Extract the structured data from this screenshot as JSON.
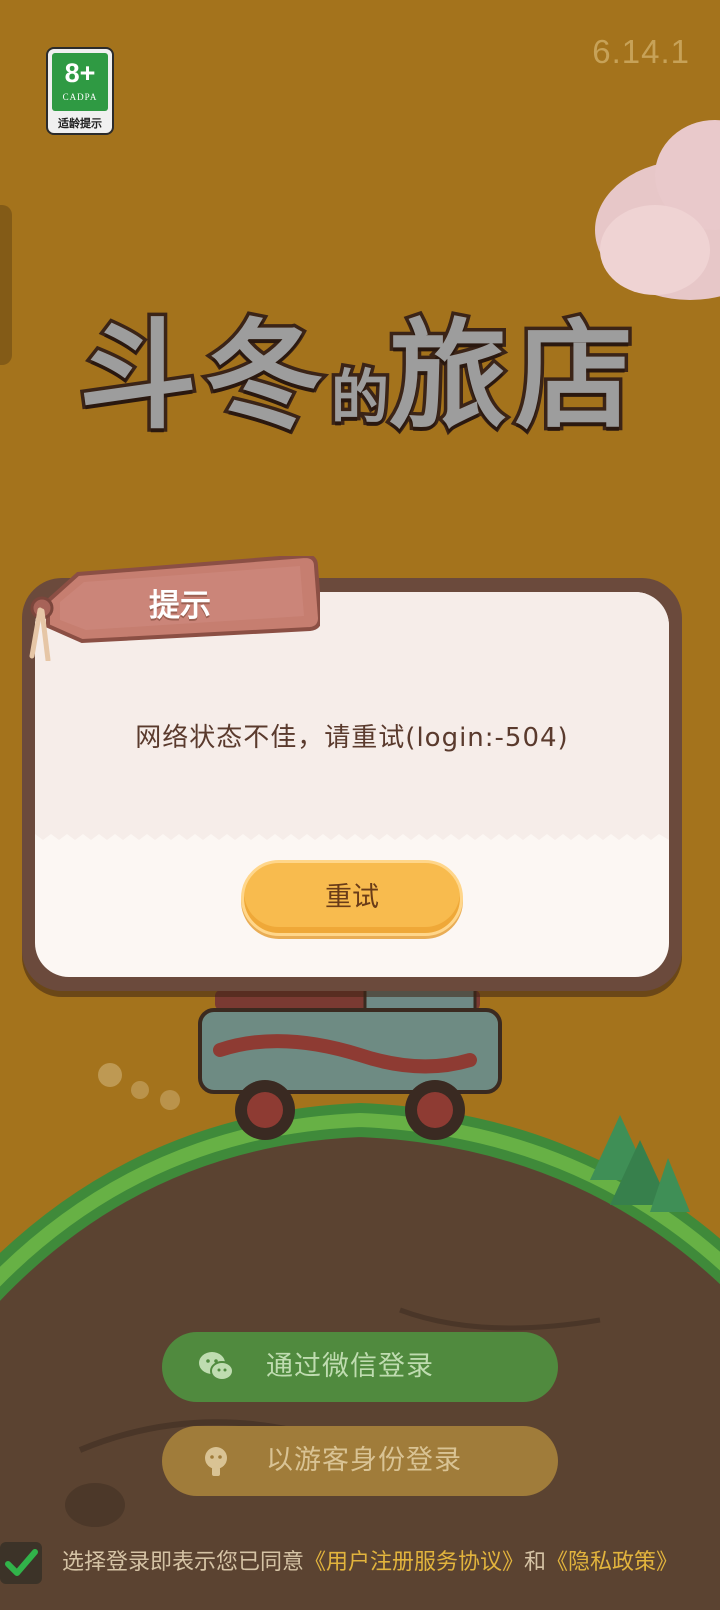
{
  "version": "6.14.1",
  "age_badge": {
    "age": "8+",
    "org": "CADPA",
    "label": "适龄提示"
  },
  "logo": {
    "title_part1": "斗冬",
    "title_part2": "的",
    "title_part3": "旅店"
  },
  "dialog": {
    "title": "提示",
    "message": "网络状态不佳，请重试(login:-504)",
    "retry_label": "重试"
  },
  "login": {
    "wechat_label": "通过微信登录",
    "guest_label": "以游客身份登录"
  },
  "agreement": {
    "prefix": "选择登录即表示您已同意",
    "user_agreement": "《用户注册服务协议》",
    "joiner": "和",
    "privacy_policy": "《隐私政策》",
    "checked": true
  },
  "colors": {
    "background": "#a4731c",
    "wechat_button": "#508a3e",
    "guest_button": "#a07c3a",
    "retry_button": "#f8bb4e",
    "dialog_frame": "#6b4a3c",
    "link": "#e2b43d"
  },
  "icons": {
    "wechat": "wechat-icon",
    "guest": "guest-icon",
    "check": "check-icon"
  }
}
